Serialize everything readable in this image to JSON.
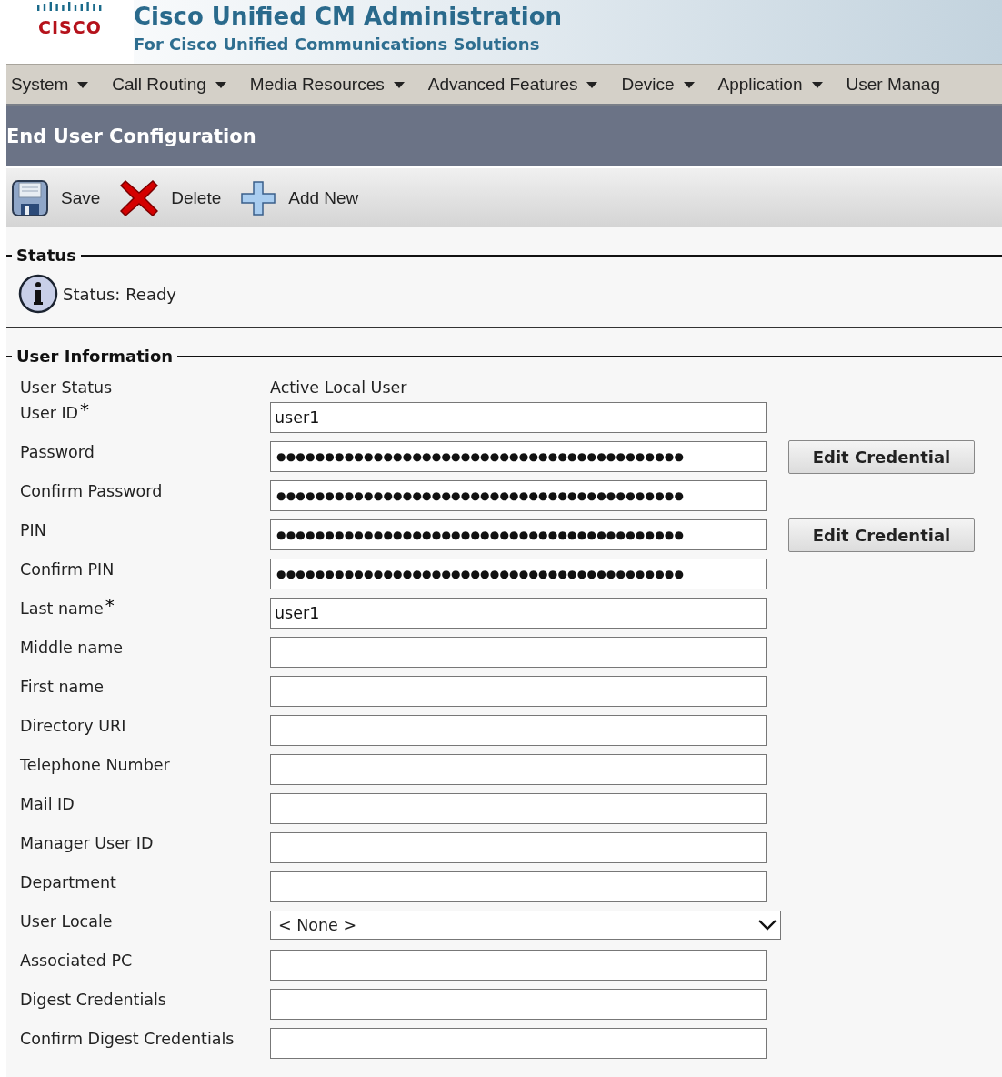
{
  "header": {
    "title": "Cisco Unified CM Administration",
    "subtitle": "For Cisco Unified Communications Solutions",
    "logo_text": "CISCO"
  },
  "menu": [
    "System",
    "Call Routing",
    "Media Resources",
    "Advanced Features",
    "Device",
    "Application",
    "User Manag"
  ],
  "page_title": "End User Configuration",
  "toolbar": [
    {
      "kind": "save",
      "label": "Save"
    },
    {
      "kind": "delete",
      "label": "Delete"
    },
    {
      "kind": "add",
      "label": "Add New"
    }
  ],
  "status": {
    "heading": "Status",
    "message": "Status: Ready"
  },
  "user_information": {
    "heading": "User Information",
    "fields": [
      {
        "kind": "static",
        "label": "User Status",
        "value": "Active Local User"
      },
      {
        "kind": "text",
        "label": "User ID",
        "required_mark": "*",
        "value": "user1"
      },
      {
        "kind": "password",
        "label": "Password",
        "value": "●●●●●●●●●●●●●●●●●●●●●●●●●●●●●●●●●●●●●●●●●●",
        "button": "Edit Credential"
      },
      {
        "kind": "password",
        "label": "Confirm Password",
        "value": "●●●●●●●●●●●●●●●●●●●●●●●●●●●●●●●●●●●●●●●●●●"
      },
      {
        "kind": "password",
        "label": "PIN",
        "value": "●●●●●●●●●●●●●●●●●●●●●●●●●●●●●●●●●●●●●●●●●●",
        "button": "Edit Credential"
      },
      {
        "kind": "password",
        "label": "Confirm PIN",
        "value": "●●●●●●●●●●●●●●●●●●●●●●●●●●●●●●●●●●●●●●●●●●"
      },
      {
        "kind": "text",
        "label": "Last name",
        "required_mark": "*",
        "value": "user1"
      },
      {
        "kind": "text",
        "label": "Middle name"
      },
      {
        "kind": "text",
        "label": "First name"
      },
      {
        "kind": "text",
        "label": "Directory URI"
      },
      {
        "kind": "text",
        "label": "Telephone Number"
      },
      {
        "kind": "text",
        "label": "Mail ID"
      },
      {
        "kind": "text",
        "label": "Manager User ID"
      },
      {
        "kind": "text",
        "label": "Department"
      },
      {
        "kind": "select",
        "label": "User Locale",
        "value": "< None >"
      },
      {
        "kind": "text",
        "label": "Associated PC"
      },
      {
        "kind": "text",
        "label": "Digest Credentials"
      },
      {
        "kind": "text",
        "label": "Confirm Digest Credentials"
      }
    ]
  }
}
